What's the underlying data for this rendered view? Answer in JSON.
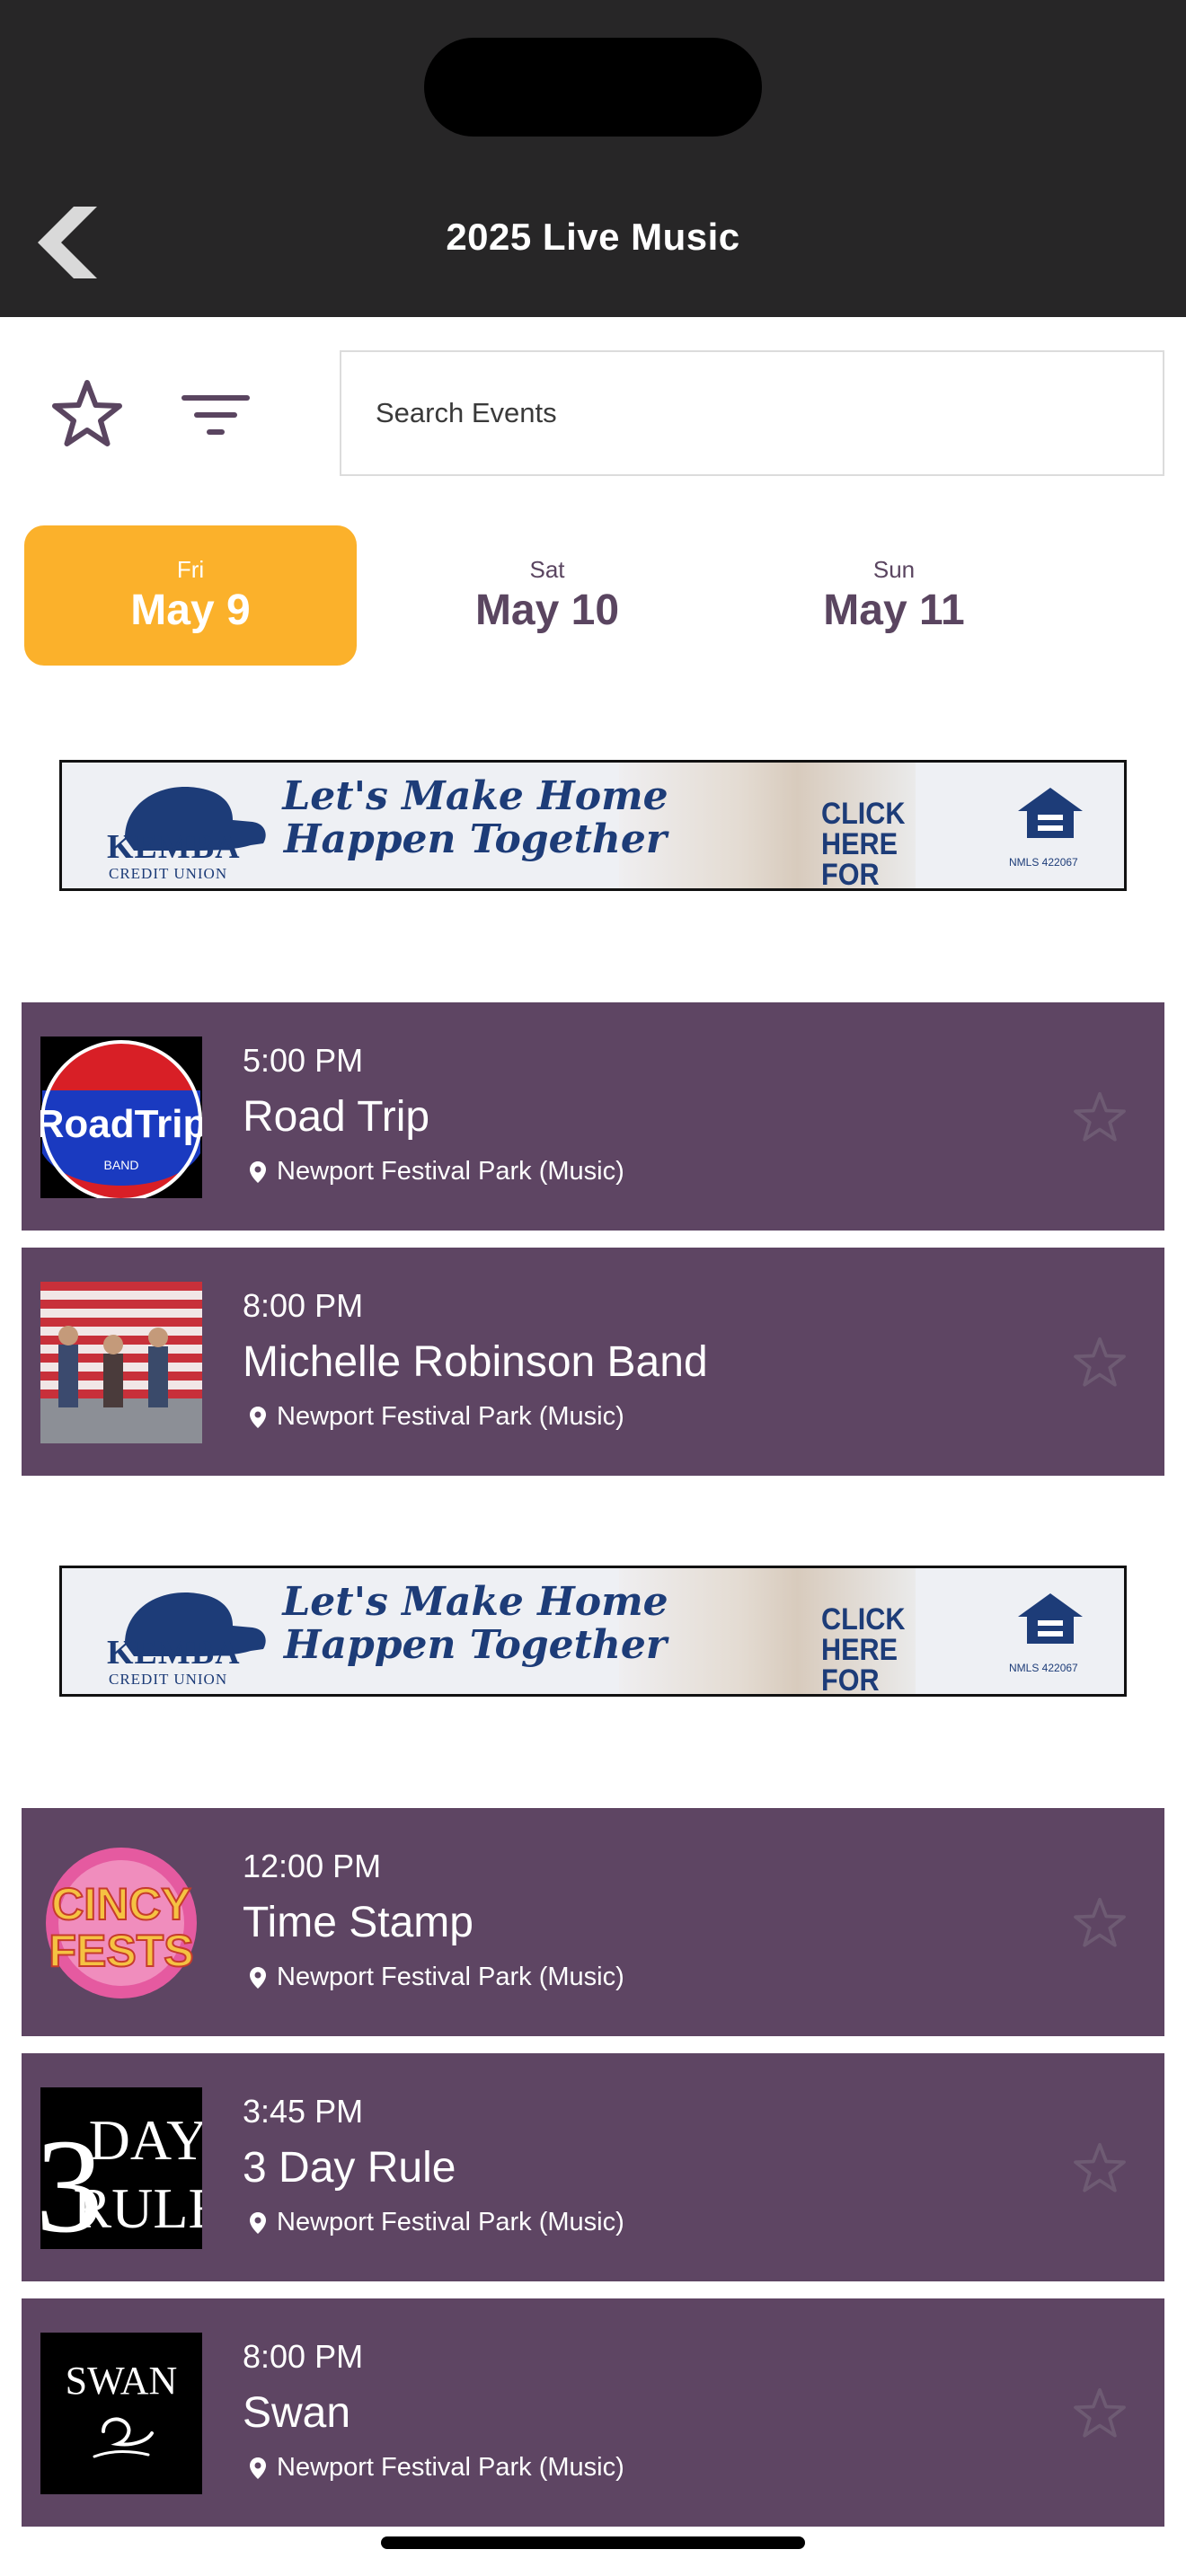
{
  "header": {
    "title": "2025 Live Music"
  },
  "toolbar": {
    "search_placeholder": "Search Events"
  },
  "day_tabs": [
    {
      "dow": "Fri",
      "date": "May 9",
      "active": true
    },
    {
      "dow": "Sat",
      "date": "May 10",
      "active": false
    },
    {
      "dow": "Sun",
      "date": "May 11",
      "active": false
    }
  ],
  "ad": {
    "brand": "KEMBA",
    "brand_sub": "CREDIT UNION",
    "tagline_1": "Let's Make Home",
    "tagline_2": "Happen Together",
    "cta_1": "CLICK HERE",
    "cta_2": "FOR DETAILS",
    "nmls": "NMLS 422067"
  },
  "events": [
    {
      "time": "5:00 PM",
      "title": "Road Trip",
      "venue": "Newport Festival Park (Music)",
      "thumb_text": "RoadTrip",
      "thumb_sub": "BAND"
    },
    {
      "time": "8:00 PM",
      "title": "Michelle Robinson Band",
      "venue": "Newport Festival Park (Music)"
    },
    {
      "time": "12:00 PM",
      "title": "Time Stamp",
      "venue": "Newport Festival Park (Music)",
      "thumb_text_1": "CINCY",
      "thumb_text_2": "FESTS"
    },
    {
      "time": "3:45 PM",
      "title": "3 Day Rule",
      "venue": "Newport Festival Park (Music)",
      "thumb_num": "3",
      "thumb_text_1": "DAY",
      "thumb_text_2": "RULE"
    },
    {
      "time": "8:00 PM",
      "title": "Swan",
      "venue": "Newport Festival Park (Music)",
      "thumb_text": "SWAN"
    }
  ],
  "colors": {
    "header_bg": "#272627",
    "accent": "#fbb12b",
    "card_bg": "#5e4563",
    "brand_text": "#5a4560"
  }
}
